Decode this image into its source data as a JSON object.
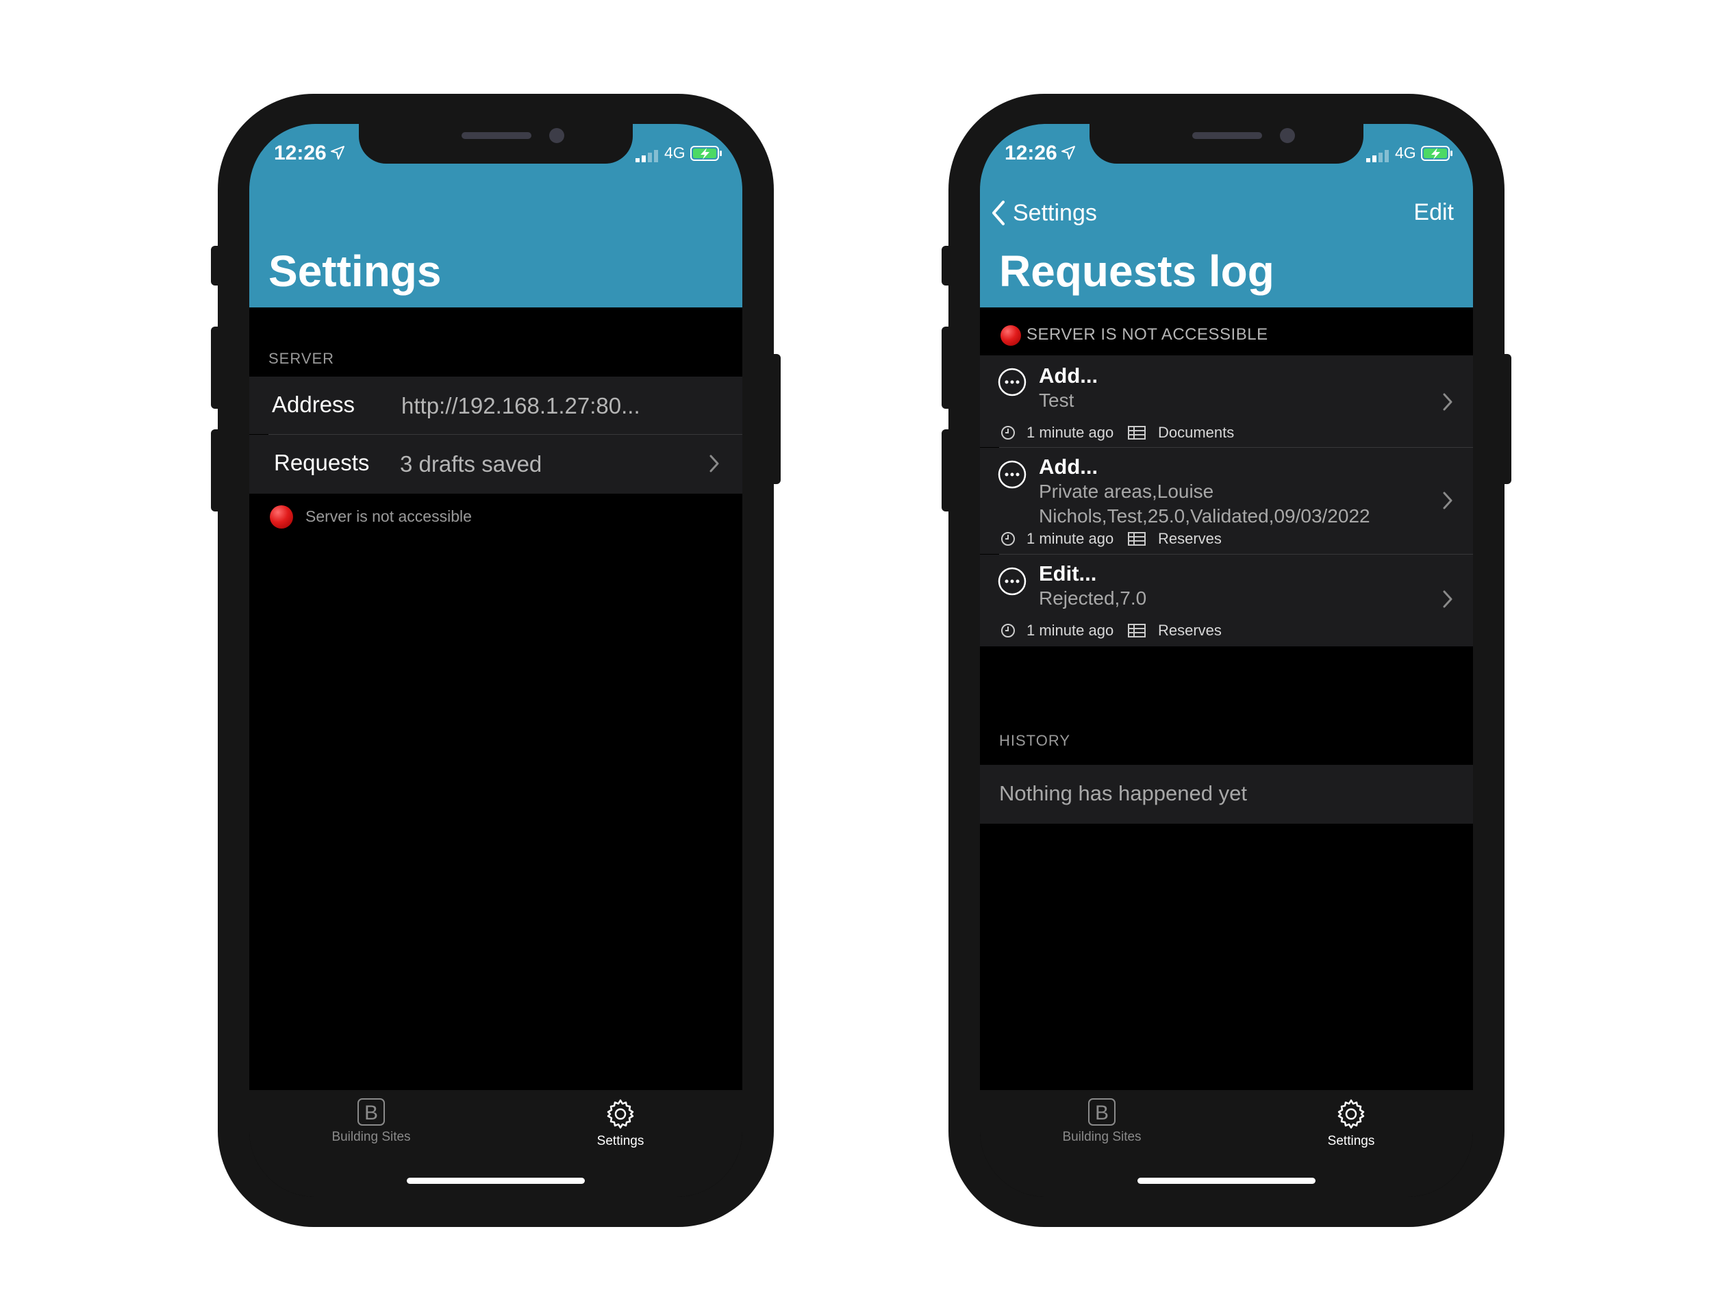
{
  "colors": {
    "header": "#3593b5",
    "background": "#000000",
    "cell": "#1c1c1e",
    "tab_active": "#ffffff",
    "tab_inactive": "#8a8a8a",
    "status_red": "#e11b1b"
  },
  "status_bar": {
    "time": "12:26",
    "network": "4G",
    "icons": [
      "location-arrow-icon",
      "signal-bars-icon",
      "battery-charging-icon"
    ]
  },
  "settings_screen": {
    "title": "Settings",
    "server_section": "SERVER",
    "address_label": "Address",
    "address_value": "http://192.168.1.27:80...",
    "requests_label": "Requests",
    "requests_value": "3 drafts saved",
    "status_text": "Server is not accessible"
  },
  "requests_screen": {
    "back_label": "Settings",
    "edit_label": "Edit",
    "title": "Requests log",
    "status_banner": "SERVER IS NOT ACCESSIBLE",
    "requests": [
      {
        "title": "Add...",
        "detail": [
          "Test"
        ],
        "time": "1 minute ago",
        "table": "Documents"
      },
      {
        "title": "Add...",
        "detail": [
          "Private areas,Louise",
          "Nichols,Test,25.0,Validated,09/03/2022"
        ],
        "time": "1 minute ago",
        "table": "Reserves"
      },
      {
        "title": "Edit...",
        "detail": [
          "Rejected,7.0"
        ],
        "time": "1 minute ago",
        "table": "Reserves"
      }
    ],
    "history_section": "HISTORY",
    "history_empty": "Nothing has happened yet"
  },
  "tabbar": {
    "tabs": [
      {
        "label": "Building Sites",
        "icon": "building-sites-b-icon",
        "active": false
      },
      {
        "label": "Settings",
        "icon": "gear-icon",
        "active": true
      }
    ]
  }
}
